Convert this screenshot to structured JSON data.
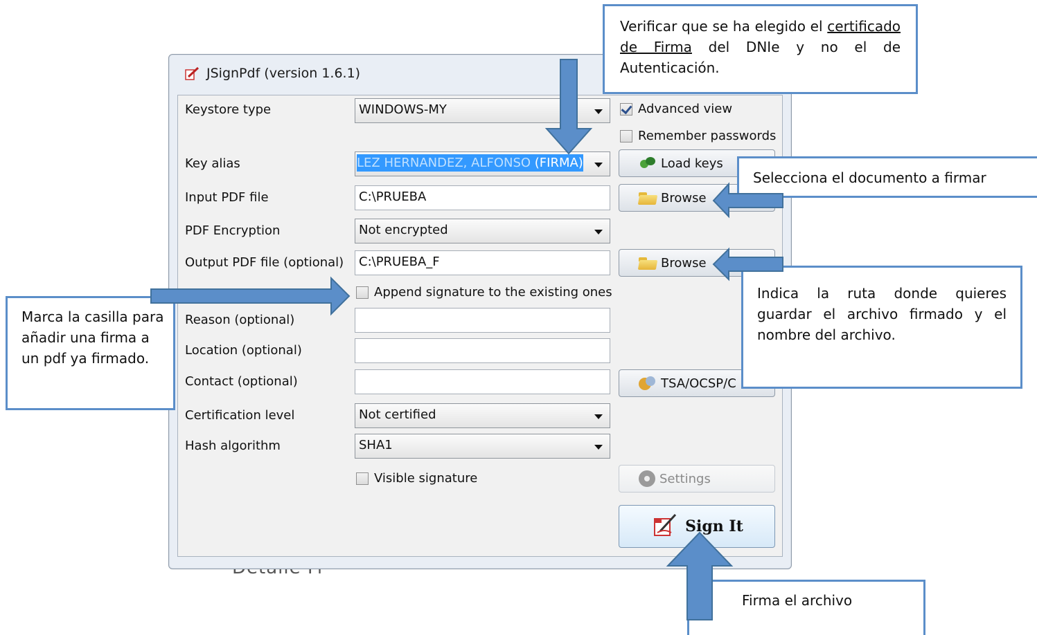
{
  "window": {
    "title": "JSignPdf (version 1.6.1)",
    "icon": "pdf-pen-icon"
  },
  "form": {
    "keystore_type": {
      "label": "Keystore type",
      "value": "WINDOWS-MY"
    },
    "advanced_view": {
      "label": "Advanced view",
      "checked": true
    },
    "remember_passwords": {
      "label": "Remember passwords",
      "checked": false
    },
    "key_alias": {
      "label": "Key alias",
      "value_highlighted": "LEZ HERNANDEZ, ALFONSO",
      "value_suffix": " (FIRMA)"
    },
    "load_keys": {
      "label": "Load keys",
      "icon": "keys-icon"
    },
    "input_pdf": {
      "label": "Input PDF file",
      "value": "C:\\PRUEBA",
      "browse": "Browse"
    },
    "pdf_encryption": {
      "label": "PDF Encryption",
      "value": "Not encrypted"
    },
    "output_pdf": {
      "label": "Output PDF file (optional)",
      "value": "C:\\PRUEBA_F",
      "browse": "Browse"
    },
    "append_signature": {
      "label": "Append signature to the existing ones",
      "checked": false
    },
    "reason": {
      "label": "Reason (optional)",
      "value": ""
    },
    "location": {
      "label": "Location (optional)",
      "value": ""
    },
    "contact": {
      "label": "Contact (optional)",
      "value": ""
    },
    "tsa_button": "TSA/OCSP/C",
    "certification_level": {
      "label": "Certification level",
      "value": "Not certified"
    },
    "hash_algorithm": {
      "label": "Hash algorithm",
      "value": "SHA1"
    },
    "visible_signature": {
      "label": "Visible signature",
      "checked": false
    },
    "settings_button": "Settings",
    "sign_button": "Sign It"
  },
  "background_fragment": "Detalle Fi",
  "callouts": {
    "certificate": {
      "part1": "Verificar que se ha elegido el",
      "underlined": "certificado de Firma",
      "part2": " del DNIe y no el de Autenticación."
    },
    "select_doc": "Selecciona el documento a firmar",
    "output_path": "Indica la ruta donde quieres guardar el archivo firmado y el nombre del archivo.",
    "append": "Marca la casilla para añadir una firma a un pdf  ya firmado.",
    "sign": "Firma el archivo"
  },
  "colors": {
    "callout_border": "#5b8ec9",
    "arrow_fill": "#5b8ec9",
    "selection": "#3399ff"
  }
}
